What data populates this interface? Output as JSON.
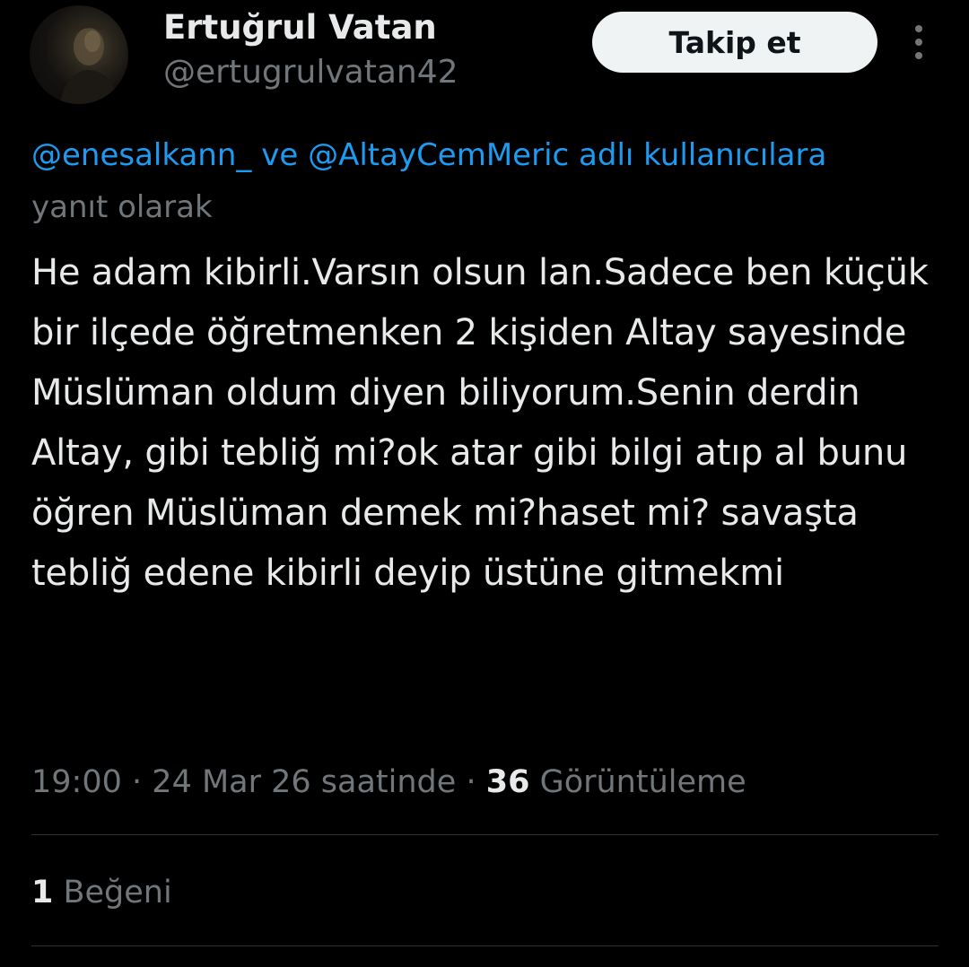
{
  "author": {
    "display_name": "Ertuğrul Vatan",
    "handle": "@ertugrulvatan42",
    "avatar_icon": "user-photo"
  },
  "actions": {
    "follow_label": "Takip et",
    "more_icon": "more-vertical-icon"
  },
  "reply_context": {
    "mention_1": "@enesalkann_",
    "connector": "ve",
    "mention_2": "@AltayCemMeric",
    "suffix": "adlı kullanıcılara yanıt olarak"
  },
  "tweet": {
    "text": "He adam kibirli.Varsın olsun lan.Sadece ben küçük bir ilçede öğretmenken 2 kişiden Altay sayesinde Müslüman oldum diyen biliyorum.Senin derdin Altay, gibi tebliğ mi?ok atar gibi bilgi atıp al bunu öğren Müslüman demek mi?haset mi? savaşta tebliğ edene kibirli deyip üstüne gitmekmi"
  },
  "meta": {
    "time": "19:00",
    "date": "24 Mar 26 saatinde",
    "separator": "·",
    "views_count": "36",
    "views_label": "Görüntüleme"
  },
  "stats": {
    "likes_count": "1",
    "likes_label": "Beğeni"
  },
  "colors": {
    "background": "#000000",
    "text_primary": "#e7e9ea",
    "text_secondary": "#71767b",
    "link": "#1d9bf0",
    "divider": "#2f3336",
    "button_bg": "#eff3f4"
  }
}
